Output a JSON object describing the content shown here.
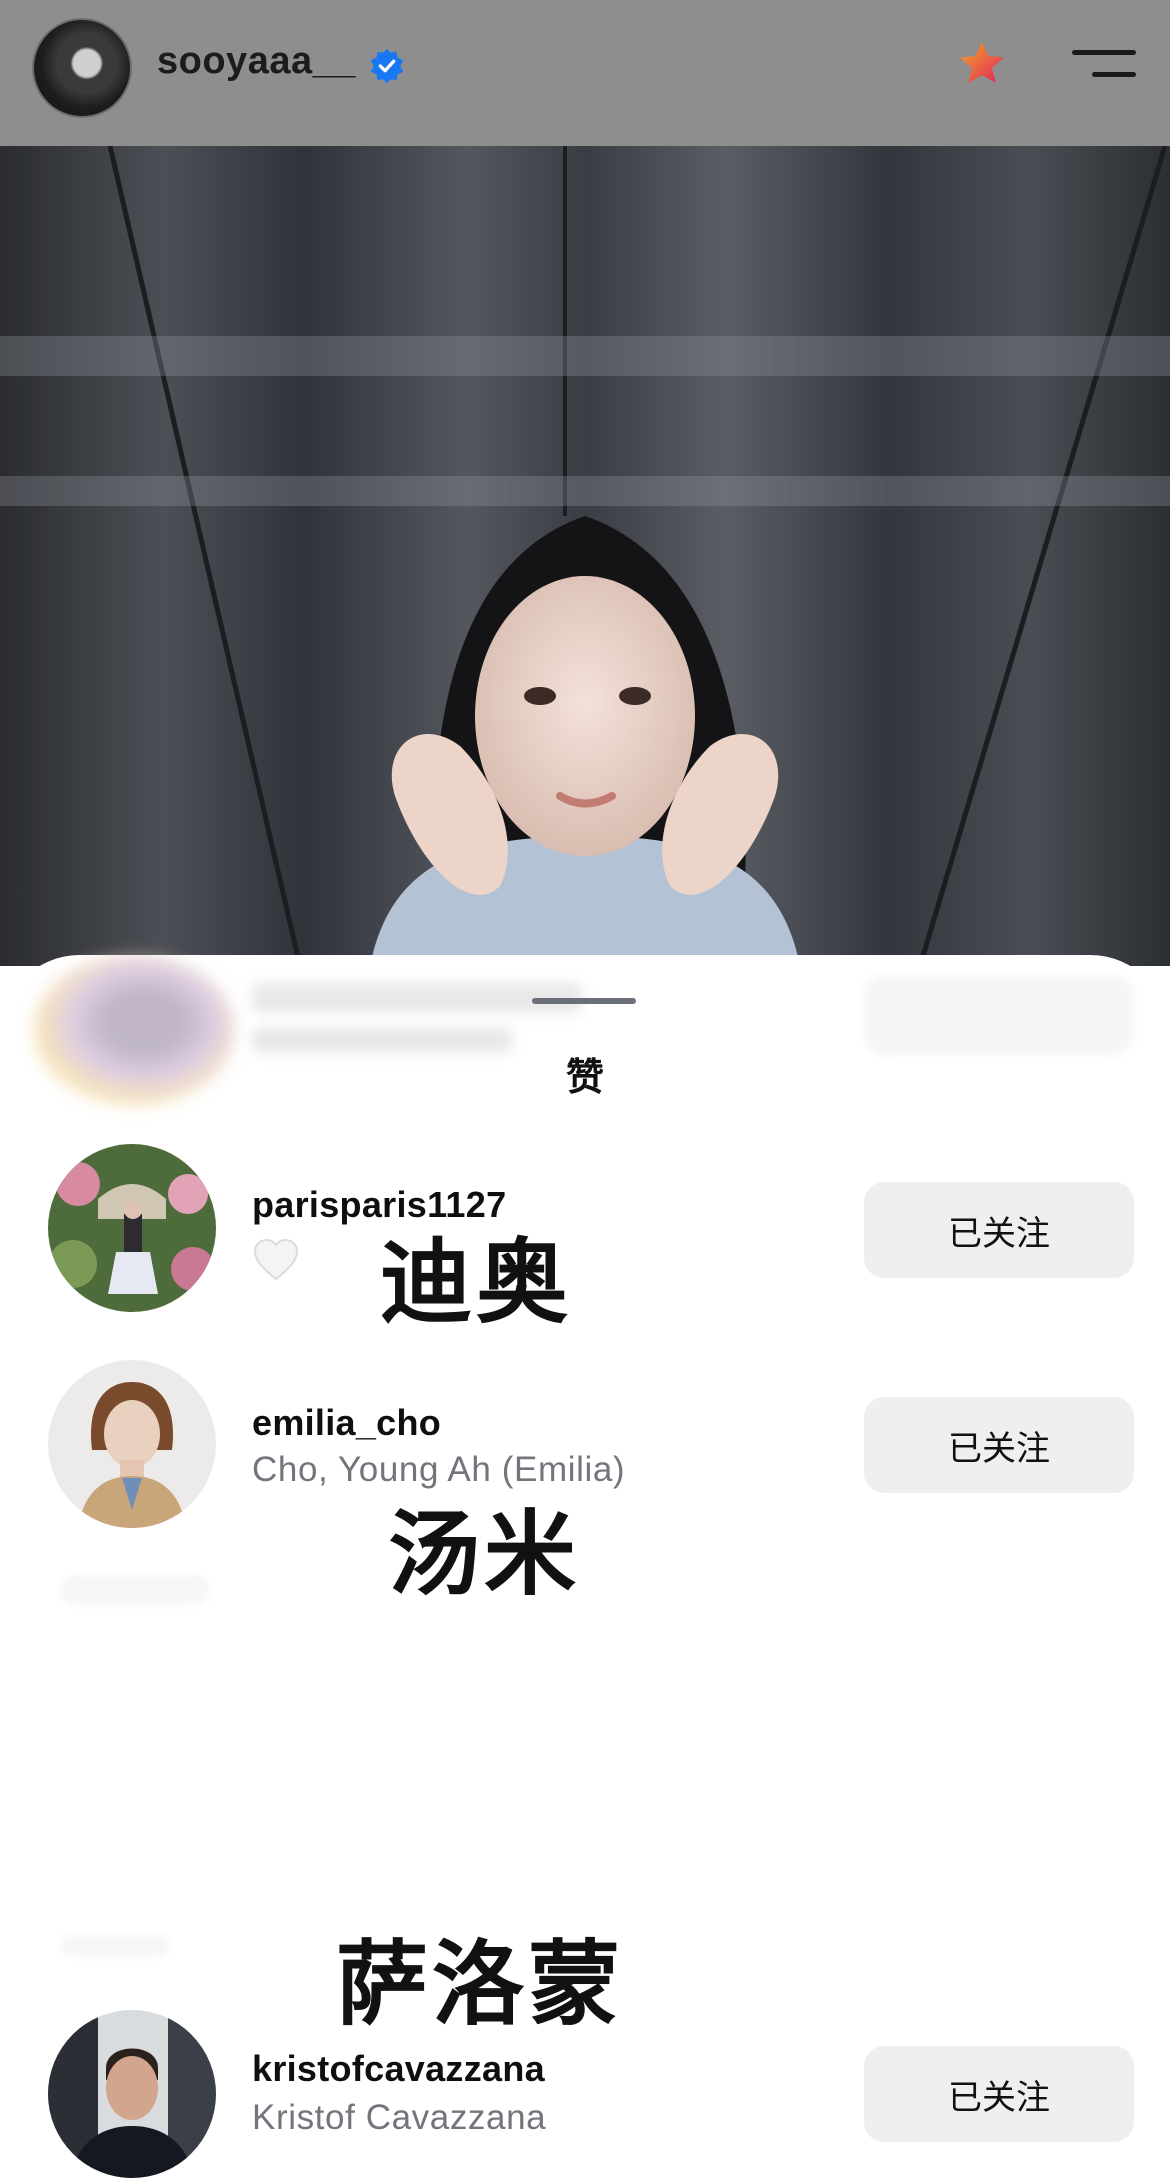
{
  "header": {
    "username": "sooyaaa__",
    "verified_icon": "verified-badge-icon",
    "star_icon": "star-icon",
    "menu_icon": "menu-icon"
  },
  "sheet": {
    "title": "赞"
  },
  "likes": [
    {
      "username": "parisparis1127",
      "subtitle_icon": "heart-icon",
      "follow_label": "已关注",
      "overlay": "迪奥"
    },
    {
      "username": "emilia_cho",
      "full_name": "Cho, Young Ah (Emilia)",
      "follow_label": "已关注",
      "overlay": "汤米"
    },
    {
      "username": "kristofcavazzana",
      "full_name": "Kristof Cavazzana",
      "follow_label": "已关注",
      "overlay": "萨洛蒙"
    }
  ],
  "colors": {
    "verified": "#1877f2",
    "star_orange": "#f5a623",
    "star_red": "#e0245e",
    "button_bg": "#efeff2"
  }
}
